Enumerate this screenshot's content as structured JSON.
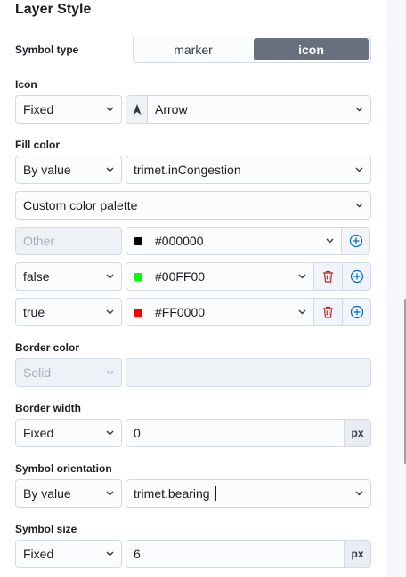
{
  "panel": {
    "title": "Layer Style"
  },
  "symbol_type": {
    "label": "Symbol type",
    "options": [
      "marker",
      "icon"
    ],
    "selected": "icon"
  },
  "icon": {
    "label": "Icon",
    "mode": "Fixed",
    "value": "Arrow",
    "value_icon": "arrow-icon"
  },
  "fill_color": {
    "label": "Fill color",
    "mode": "By value",
    "field": "trimet.inCongestion",
    "palette": "Custom color palette",
    "stops": [
      {
        "key_placeholder": "Other",
        "color_hex": "#000000",
        "swatch": "#000000"
      },
      {
        "key": "false",
        "color_hex": "#00FF00",
        "swatch": "#00ff00"
      },
      {
        "key": "true",
        "color_hex": "#FF0000",
        "swatch": "#ff0000"
      }
    ]
  },
  "border_color": {
    "label": "Border color",
    "mode": "Solid"
  },
  "border_width": {
    "label": "Border width",
    "mode": "Fixed",
    "value": "0",
    "unit": "px"
  },
  "symbol_orientation": {
    "label": "Symbol orientation",
    "mode": "By value",
    "field": "trimet.bearing"
  },
  "symbol_size": {
    "label": "Symbol size",
    "mode": "Fixed",
    "value": "6",
    "unit": "px"
  },
  "colors": {
    "accent": "#006bb8",
    "danger": "#bd271e",
    "toggle_selected": "#69707d"
  }
}
